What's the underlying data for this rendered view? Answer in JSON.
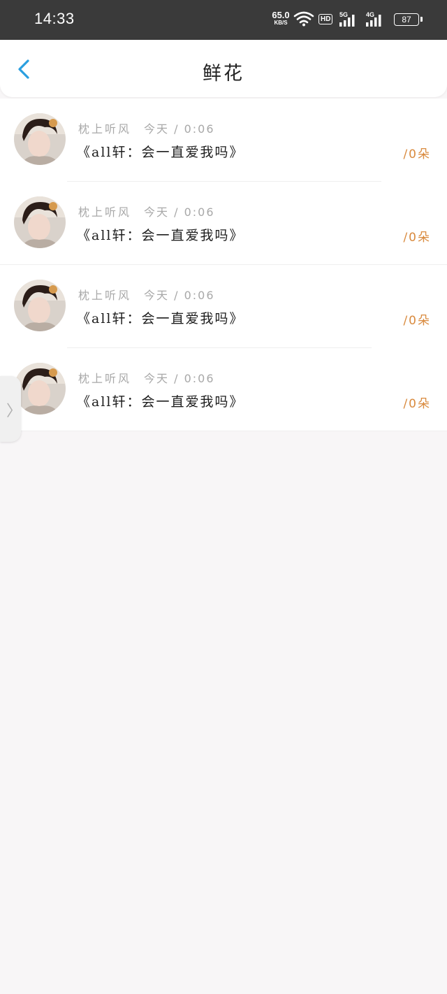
{
  "status_bar": {
    "time": "14:33",
    "net_speed_value": "65.0",
    "net_speed_unit": "KB/S",
    "hd_label": "HD",
    "signal_1_label": "5G",
    "signal_2_label": "4G",
    "battery": "87"
  },
  "header": {
    "title": "鲜花",
    "back_icon": "chevron-left-icon"
  },
  "items": [
    {
      "author": "枕上听风",
      "time": "今天 / 0:06",
      "title": "《all轩：会一直爱我吗》",
      "count": "/0朵"
    },
    {
      "author": "枕上听风",
      "time": "今天 / 0:06",
      "title": "《all轩：会一直爱我吗》",
      "count": "/0朵"
    },
    {
      "author": "枕上听风",
      "time": "今天 / 0:06",
      "title": "《all轩：会一直爱我吗》",
      "count": "/0朵"
    },
    {
      "author": "枕上听风",
      "time": "今天 / 0:06",
      "title": "《all轩：会一直爱我吗》",
      "count": "/0朵"
    }
  ],
  "side_handle": {
    "icon": "chevron-right-icon",
    "glyph": "〉"
  },
  "colors": {
    "accent": "#2a9fe0",
    "count": "#d98a3e",
    "background": "#f8f6f7"
  }
}
